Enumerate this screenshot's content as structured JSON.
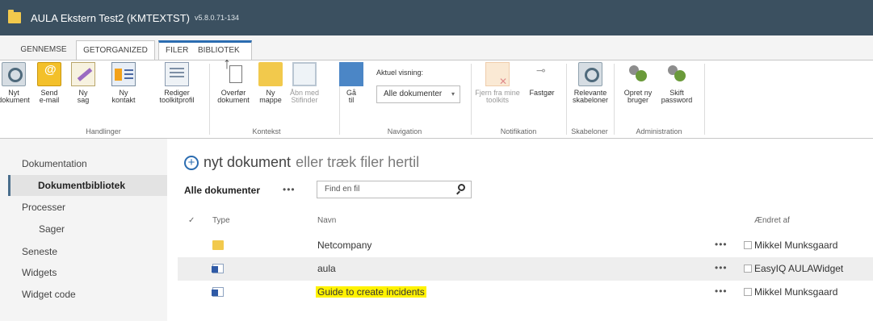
{
  "titlebar": {
    "title": "AULA Ekstern Test2 (KMTEXTST)",
    "version": "v5.8.0.71-134"
  },
  "tabs": [
    "GENNEMSE",
    "GETORGANIZED",
    "FILER",
    "BIBLIOTEK"
  ],
  "ribbon": {
    "handlinger": {
      "label": "Handlinger",
      "buttons": [
        "Nyt\ndokument",
        "Send\ne-mail",
        "Ny\nsag",
        "Ny\nkontakt",
        "Rediger\ntoolkitprofil"
      ]
    },
    "kontekst": {
      "label": "Kontekst",
      "buttons": [
        "Overfør\ndokument",
        "Ny\nmappe",
        "Åbn med\nStifinder"
      ]
    },
    "navigation": {
      "label": "Navigation",
      "goto": "Gå\ntil",
      "view_label": "Aktuel visning:",
      "view_value": "Alle dokumenter"
    },
    "notifikation": {
      "label": "Notifikation",
      "buttons": [
        "Fjern fra mine\ntoolkits",
        "Fastgør"
      ]
    },
    "skabeloner": {
      "label": "Skabeloner",
      "buttons": [
        "Relevante\nskabeloner"
      ]
    },
    "administration": {
      "label": "Administration",
      "buttons": [
        "Opret ny\nbruger",
        "Skift\npassword"
      ]
    }
  },
  "leftnav": [
    "Dokumentation",
    "Dokumentbibliotek",
    "Processer",
    "Sager",
    "Seneste",
    "Widgets",
    "Widget code"
  ],
  "main": {
    "new_doc_a": "nyt dokument",
    "new_doc_b": "eller træk filer hertil",
    "view_name": "Alle dokumenter",
    "more": "•••",
    "search_placeholder": "Find en fil",
    "columns": {
      "check": "✓",
      "type": "Type",
      "name": "Navn",
      "modified_by": "Ændret af"
    },
    "rows": [
      {
        "type": "folder",
        "name": "Netcompany",
        "modified_by": "Mikkel Munksgaard"
      },
      {
        "type": "word",
        "name": "aula",
        "modified_by": "EasyIQ AULAWidget"
      },
      {
        "type": "word",
        "name": "Guide to create incidents",
        "modified_by": "Mikkel Munksgaard"
      }
    ]
  },
  "colors": {
    "titlebar": "#3b5060",
    "accent": "#2b6cb0",
    "highlight": "#fff200"
  }
}
